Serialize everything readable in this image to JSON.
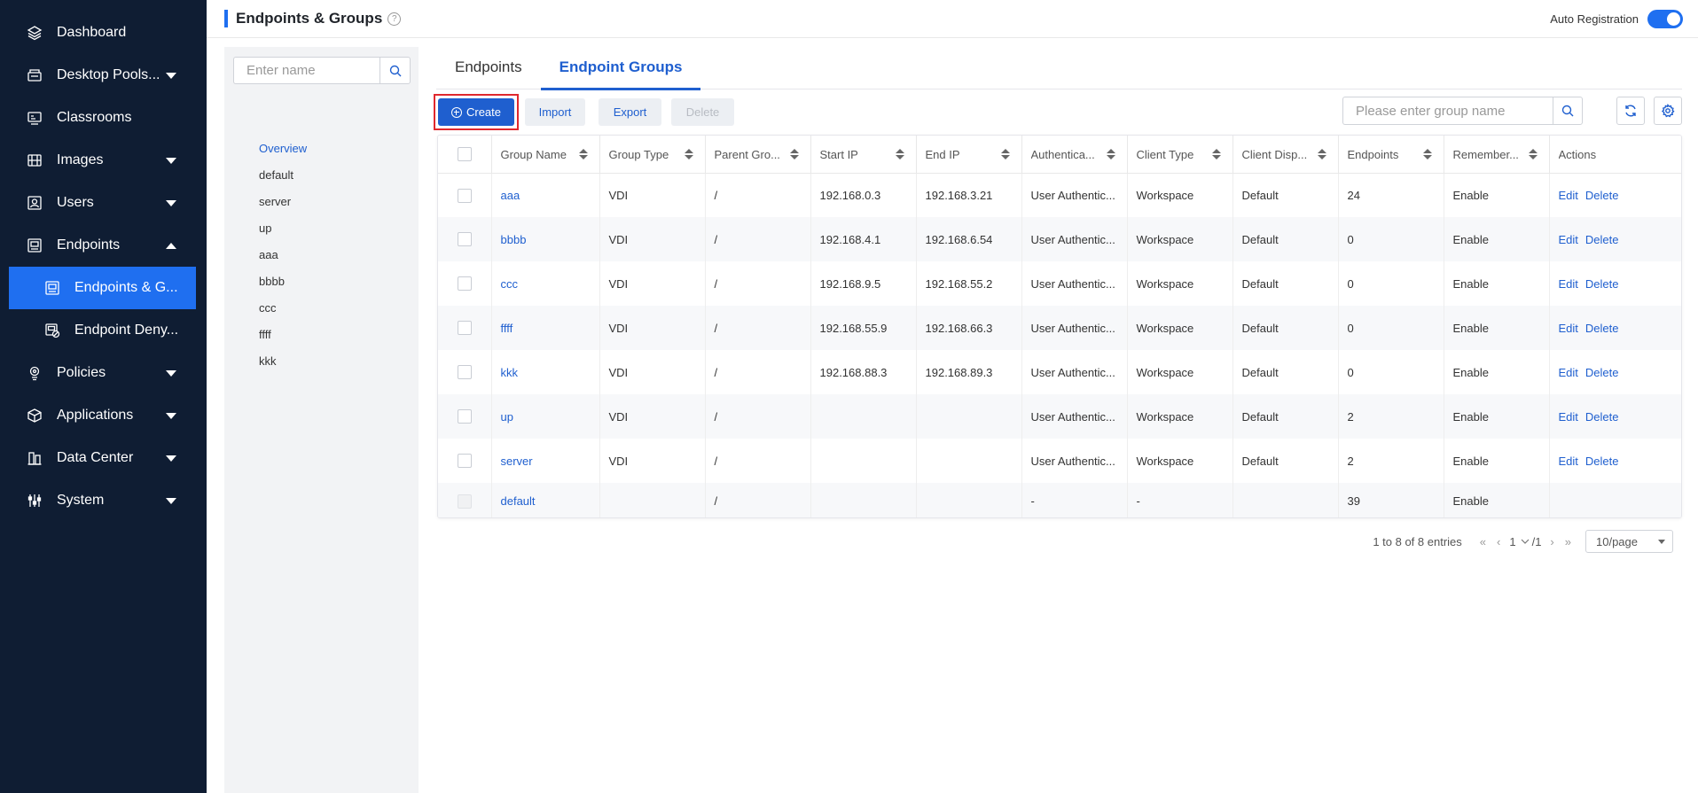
{
  "sidebar": {
    "items": [
      {
        "label": "Dashboard",
        "icon": "layers-icon"
      },
      {
        "label": "Desktop Pools...",
        "icon": "desktop-pool-icon",
        "caret": "down"
      },
      {
        "label": "Classrooms",
        "icon": "classroom-icon"
      },
      {
        "label": "Images",
        "icon": "image-icon",
        "caret": "down"
      },
      {
        "label": "Users",
        "icon": "user-icon",
        "caret": "down"
      },
      {
        "label": "Endpoints",
        "icon": "endpoint-icon",
        "caret": "up"
      },
      {
        "label": "Endpoints & G...",
        "icon": "endpoint-group-icon",
        "sub": true,
        "active": true
      },
      {
        "label": "Endpoint Deny...",
        "icon": "endpoint-deny-icon",
        "sub": true
      },
      {
        "label": "Policies",
        "icon": "policy-icon",
        "caret": "down"
      },
      {
        "label": "Applications",
        "icon": "application-icon",
        "caret": "down"
      },
      {
        "label": "Data Center",
        "icon": "data-center-icon",
        "caret": "down"
      },
      {
        "label": "System",
        "icon": "system-icon",
        "caret": "down"
      }
    ]
  },
  "header": {
    "title": "Endpoints & Groups",
    "help": "?",
    "auto_registration_label": "Auto Registration",
    "auto_registration_on": true
  },
  "tree": {
    "search_placeholder": "Enter name",
    "items": [
      "Overview",
      "default",
      "server",
      "up",
      "aaa",
      "bbbb",
      "ccc",
      "ffff",
      "kkk"
    ]
  },
  "tabs": [
    {
      "label": "Endpoints",
      "active": false
    },
    {
      "label": "Endpoint Groups",
      "active": true
    }
  ],
  "toolbar": {
    "create_label": "Create",
    "import_label": "Import",
    "export_label": "Export",
    "delete_label": "Delete",
    "search_placeholder": "Please enter group name"
  },
  "table": {
    "columns": [
      "Group Name",
      "Group Type",
      "Parent Gro...",
      "Start IP",
      "End IP",
      "Authentica...",
      "Client Type",
      "Client Disp...",
      "Endpoints",
      "Remember...",
      "Actions"
    ],
    "rows": [
      {
        "name": "aaa",
        "type": "VDI",
        "parent": "/",
        "start_ip": "192.168.0.3",
        "end_ip": "192.168.3.21",
        "auth": "User Authentic...",
        "client_type": "Workspace",
        "client_disp": "Default",
        "endpoints": "24",
        "remember": "Enable",
        "edit": "Edit",
        "delete": "Delete"
      },
      {
        "name": "bbbb",
        "type": "VDI",
        "parent": "/",
        "start_ip": "192.168.4.1",
        "end_ip": "192.168.6.54",
        "auth": "User Authentic...",
        "client_type": "Workspace",
        "client_disp": "Default",
        "endpoints": "0",
        "remember": "Enable",
        "edit": "Edit",
        "delete": "Delete"
      },
      {
        "name": "ccc",
        "type": "VDI",
        "parent": "/",
        "start_ip": "192.168.9.5",
        "end_ip": "192.168.55.2",
        "auth": "User Authentic...",
        "client_type": "Workspace",
        "client_disp": "Default",
        "endpoints": "0",
        "remember": "Enable",
        "edit": "Edit",
        "delete": "Delete"
      },
      {
        "name": "ffff",
        "type": "VDI",
        "parent": "/",
        "start_ip": "192.168.55.9",
        "end_ip": "192.168.66.3",
        "auth": "User Authentic...",
        "client_type": "Workspace",
        "client_disp": "Default",
        "endpoints": "0",
        "remember": "Enable",
        "edit": "Edit",
        "delete": "Delete"
      },
      {
        "name": "kkk",
        "type": "VDI",
        "parent": "/",
        "start_ip": "192.168.88.3",
        "end_ip": "192.168.89.3",
        "auth": "User Authentic...",
        "client_type": "Workspace",
        "client_disp": "Default",
        "endpoints": "0",
        "remember": "Enable",
        "edit": "Edit",
        "delete": "Delete"
      },
      {
        "name": "up",
        "type": "VDI",
        "parent": "/",
        "start_ip": "",
        "end_ip": "",
        "auth": "User Authentic...",
        "client_type": "Workspace",
        "client_disp": "Default",
        "endpoints": "2",
        "remember": "Enable",
        "edit": "Edit",
        "delete": "Delete"
      },
      {
        "name": "server",
        "type": "VDI",
        "parent": "/",
        "start_ip": "",
        "end_ip": "",
        "auth": "User Authentic...",
        "client_type": "Workspace",
        "client_disp": "Default",
        "endpoints": "2",
        "remember": "Enable",
        "edit": "Edit",
        "delete": "Delete"
      },
      {
        "name": "default",
        "type": "",
        "parent": "/",
        "start_ip": "",
        "end_ip": "",
        "auth": "-",
        "client_type": "-",
        "client_disp": "",
        "endpoints": "39",
        "remember": "Enable",
        "edit": "",
        "delete": ""
      }
    ]
  },
  "pagination": {
    "summary": "1 to 8 of 8 entries",
    "current_page": "1",
    "total_pages": "/1",
    "page_size": "10/page"
  },
  "colors": {
    "sidebar_bg": "#0f1d33",
    "accent": "#1f6ff0",
    "link": "#1f5fcf",
    "highlight_border": "#e0282e"
  }
}
